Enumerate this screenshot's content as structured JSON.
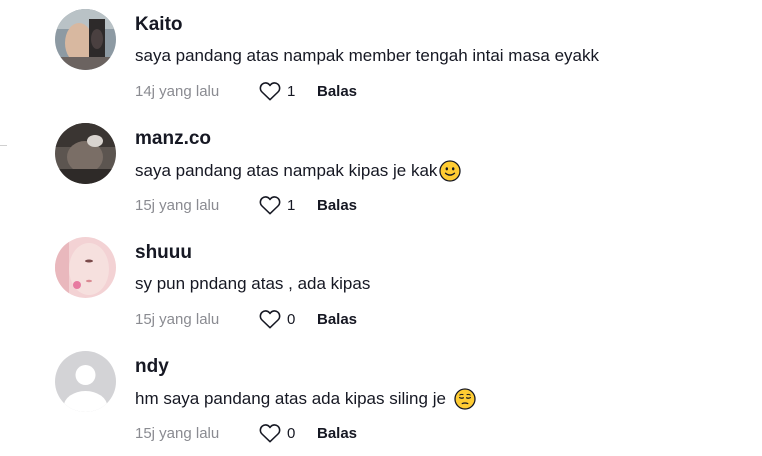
{
  "comments": [
    {
      "username": "Kaito",
      "text": "saya pandang atas nampak member tengah intai masa eyakk",
      "time": "14j yang lalu",
      "likes": "1",
      "reply": "Balas",
      "emoji": ""
    },
    {
      "username": "manz.co",
      "text": "saya pandang atas nampak kipas je kak",
      "time": "15j yang lalu",
      "likes": "1",
      "reply": "Balas",
      "emoji": "slightly-smiling-face"
    },
    {
      "username": "shuuu",
      "text": "sy pun pndang atas , ada kipas",
      "time": "15j yang lalu",
      "likes": "0",
      "reply": "Balas",
      "emoji": ""
    },
    {
      "username": "ndy",
      "text": "hm saya pandang atas ada kipas siling je",
      "time": "15j yang lalu",
      "likes": "0",
      "reply": "Balas",
      "emoji": "pensive-face"
    }
  ],
  "colors": {
    "text": "#161823",
    "meta": "#8a8b91",
    "emoji": "#ffcc33"
  }
}
